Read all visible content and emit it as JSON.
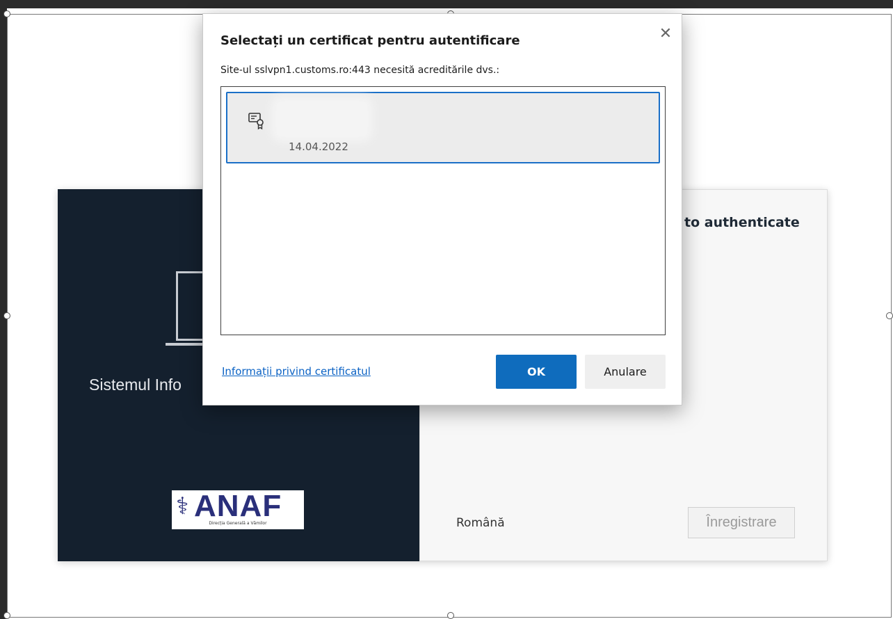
{
  "dialog": {
    "title": "Selectați un certificat pentru autentificare",
    "subtitle": "Site-ul sslvpn1.customs.ro:443 necesită acreditările dvs.:",
    "certificates": [
      {
        "icon": "certificate-icon",
        "date": "14.04.2022",
        "selected": true
      }
    ],
    "info_link": "Informații privind certificatul",
    "ok_label": "OK",
    "cancel_label": "Anulare",
    "close_icon": "close-icon",
    "accent_color": "#0f6cbd"
  },
  "background_page": {
    "system_title": "Sistemul Info",
    "auth_heading": "to authenticate",
    "language": "Română",
    "register_label": "Înregistrare",
    "logo": {
      "text": "ANAF",
      "subtitle": "Direcția Generală a Vămilor"
    },
    "left_panel_color": "#14202e"
  }
}
